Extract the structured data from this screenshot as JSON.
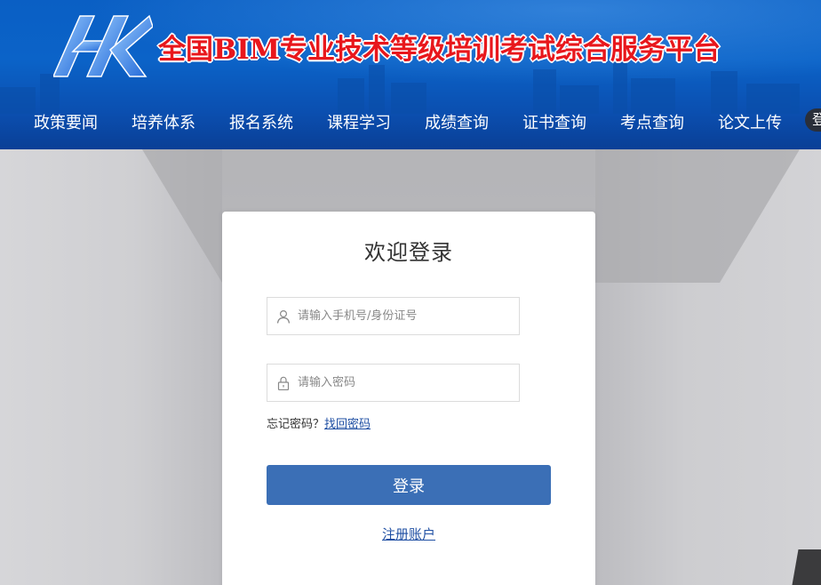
{
  "header": {
    "site_title": "全国BIM专业技术等级培训考试综合服务平台",
    "logo_icon": "hk-logo-icon"
  },
  "nav": {
    "items": [
      {
        "label": "政策要闻"
      },
      {
        "label": "培养体系"
      },
      {
        "label": "报名系统"
      },
      {
        "label": "课程学习"
      },
      {
        "label": "成绩查询"
      },
      {
        "label": "证书查询"
      },
      {
        "label": "考点查询"
      },
      {
        "label": "论文上传"
      }
    ],
    "more_label": "登"
  },
  "login": {
    "title": "欢迎登录",
    "username": {
      "placeholder": "请输入手机号/身份证号",
      "value": "",
      "icon": "user-icon"
    },
    "password": {
      "placeholder": "请输入密码",
      "value": "",
      "icon": "lock-icon"
    },
    "forgot_prefix": "忘记密码？",
    "forgot_link": "找回密码",
    "submit_label": "登录",
    "register_link": "注册账户"
  },
  "colors": {
    "header_blue": "#0b5ec4",
    "title_red": "#e8171c",
    "button_blue": "#3b6fb6",
    "link_blue": "#1f4fa3"
  }
}
